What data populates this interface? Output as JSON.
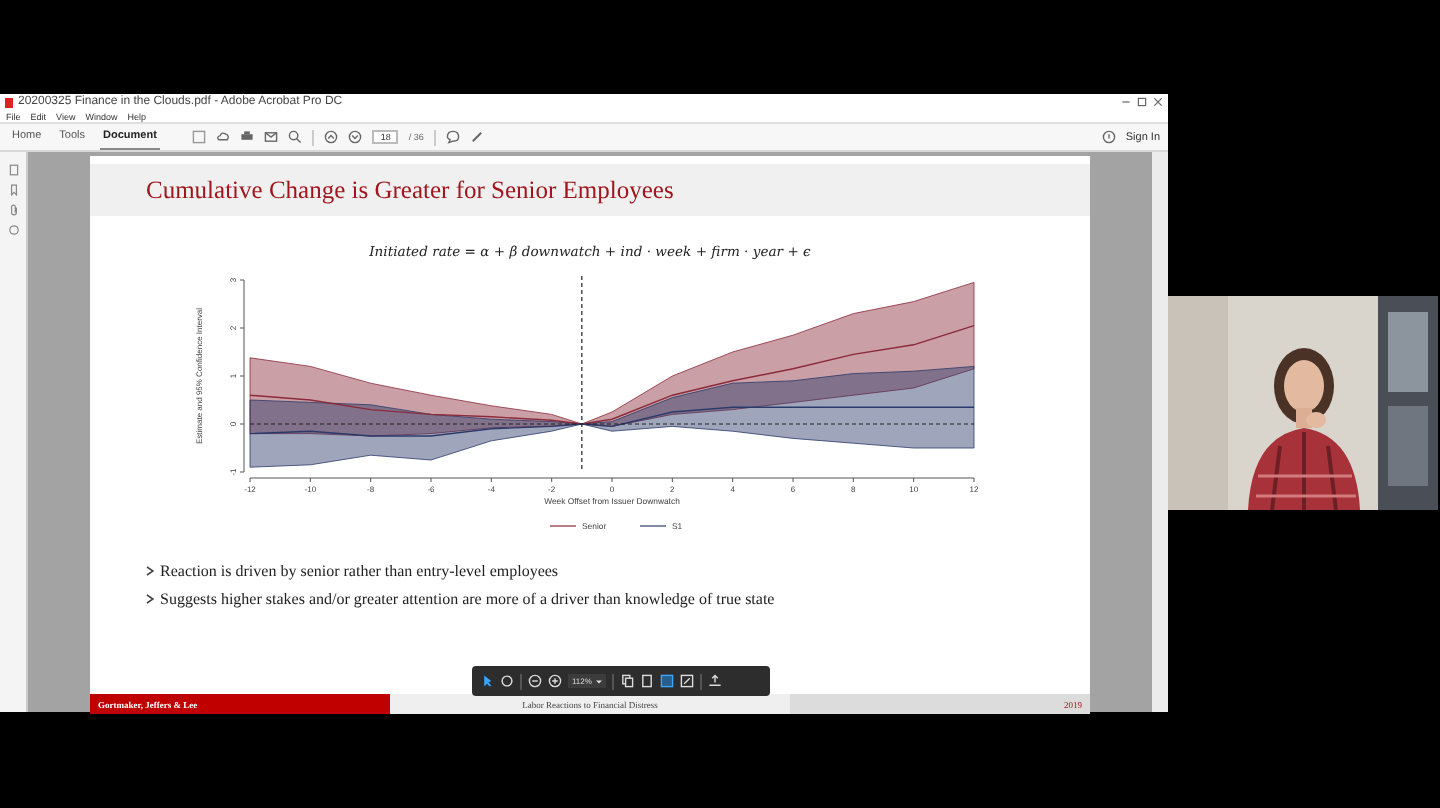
{
  "window": {
    "title": "20200325 Finance in the Clouds.pdf - Adobe Acrobat Pro DC"
  },
  "menu": [
    "File",
    "Edit",
    "View",
    "Window",
    "Help"
  ],
  "tabs": [
    {
      "label": "Home",
      "selected": false
    },
    {
      "label": "Tools",
      "selected": false
    },
    {
      "label": "Document",
      "selected": true
    }
  ],
  "page_field": {
    "value": "18",
    "total": "/ 36"
  },
  "sign_in": "Sign In",
  "slide": {
    "title": "Cumulative Change is Greater for Senior Employees",
    "formula": "Initiated rate = α + β downwatch + ind · week + firm · year + ϵ",
    "chart_data": {
      "type": "line",
      "xlabel": "Week Offset from Issuer Downwatch",
      "ylabel": "Estimate and 95% Confidence Interval",
      "x": [
        -12,
        -10,
        -8,
        -6,
        -4,
        -2,
        -1,
        0,
        2,
        4,
        6,
        8,
        10,
        12
      ],
      "series": [
        {
          "name": "Senior",
          "color": "#8b2a3a",
          "values": [
            0.6,
            0.5,
            0.3,
            0.2,
            0.15,
            0.08,
            0,
            0.1,
            0.6,
            0.9,
            1.15,
            1.45,
            1.65,
            2.05
          ],
          "upper": [
            1.38,
            1.2,
            0.85,
            0.6,
            0.38,
            0.2,
            0,
            0.25,
            1.0,
            1.5,
            1.85,
            2.3,
            2.55,
            2.95
          ],
          "lower": [
            -0.2,
            -0.2,
            -0.25,
            -0.2,
            -0.08,
            -0.04,
            0,
            -0.05,
            0.2,
            0.3,
            0.45,
            0.6,
            0.75,
            1.15
          ]
        },
        {
          "name": "S1",
          "color": "#2b3a6a",
          "values": [
            -0.2,
            -0.15,
            -0.25,
            -0.25,
            -0.1,
            -0.05,
            0,
            -0.05,
            0.25,
            0.35,
            0.35,
            0.35,
            0.35,
            0.35
          ],
          "upper": [
            0.5,
            0.45,
            0.4,
            0.2,
            0.1,
            0.05,
            0,
            0.05,
            0.55,
            0.85,
            0.9,
            1.05,
            1.1,
            1.2
          ],
          "lower": [
            -0.9,
            -0.85,
            -0.65,
            -0.75,
            -0.35,
            -0.15,
            0,
            -0.15,
            -0.05,
            -0.15,
            -0.3,
            -0.4,
            -0.5,
            -0.5
          ]
        }
      ],
      "legend": "bottom",
      "xlim": [
        -12,
        12
      ],
      "ylim": [
        -1,
        3
      ],
      "xticks": [
        -12,
        -10,
        -8,
        -6,
        -4,
        -2,
        0,
        2,
        4,
        6,
        8,
        10,
        12
      ],
      "yticks": [
        -1,
        0,
        1,
        2,
        3
      ],
      "ref_lines": [
        {
          "axis": "y",
          "value": 0
        },
        {
          "axis": "x",
          "value": -1
        }
      ]
    },
    "bullets": [
      "Reaction is driven by senior rather than entry-level employees",
      "Suggests higher stakes and/or greater attention are more of a driver than knowledge of true state"
    ],
    "footer": {
      "authors": "Gortmaker, Jeffers & Lee",
      "title": "Labor Reactions to Financial Distress",
      "year": "2019"
    }
  },
  "float_toolbar": {
    "zoom": "112%"
  }
}
